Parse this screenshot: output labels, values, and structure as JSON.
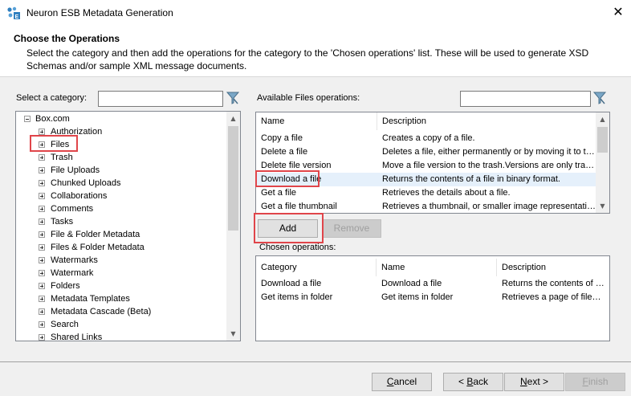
{
  "window": {
    "title": "Neuron ESB Metadata Generation",
    "close_glyph": "✕"
  },
  "header": {
    "title": "Choose the Operations",
    "description": "Select the category and then add the operations for the category to the 'Chosen operations' list. These will be used to generate XSD Schemas and/or sample XML message documents."
  },
  "category": {
    "label": "Select a category:",
    "search_value": "",
    "root": "Box.com",
    "items": [
      "Authorization",
      "Files",
      "Trash",
      "File Uploads",
      "Chunked Uploads",
      "Collaborations",
      "Comments",
      "Tasks",
      "File & Folder Metadata",
      "Files & Folder Metadata",
      "Watermarks",
      "Watermark",
      "Folders",
      "Metadata Templates",
      "Metadata Cascade (Beta)",
      "Search",
      "Shared Links"
    ],
    "selected": "Files"
  },
  "available": {
    "label": "Available Files operations:",
    "search_value": "",
    "columns": [
      "Name",
      "Description"
    ],
    "rows": [
      [
        "Copy a file",
        "Creates a copy of a file."
      ],
      [
        "Delete a file",
        "Deletes a file, either permanently or by moving it to the trash."
      ],
      [
        "Delete file version",
        "Move a file version to the trash.Versions are only tracked for premium accounts."
      ],
      [
        "Download a file",
        "Returns the contents of a file in binary format."
      ],
      [
        "Get a file",
        "Retrieves the details about a file."
      ],
      [
        "Get a file thumbnail",
        "Retrieves a thumbnail, or smaller image representation, of this file."
      ]
    ],
    "highlighted_row": "Download a file"
  },
  "actions": {
    "add": "Add",
    "remove": "Remove"
  },
  "chosen": {
    "label": "Chosen operations:",
    "columns": [
      "Category",
      "Name",
      "Description"
    ],
    "rows": [
      [
        "Download a file",
        "Download a file",
        "Returns the contents of a file in binary format."
      ],
      [
        "Get items in folder",
        "Get items in folder",
        "Retrieves a page of files and folders in a folder."
      ]
    ]
  },
  "footer": {
    "cancel": {
      "text": "Cancel",
      "accel": "C",
      "rest": "ancel"
    },
    "back": {
      "text": "< Back",
      "pre": "< ",
      "accel": "B",
      "rest": "ack"
    },
    "next": {
      "text": "Next >",
      "accel": "N",
      "rest": "ext >"
    },
    "finish": {
      "text": "Finish",
      "accel": "F",
      "rest": "inish"
    }
  },
  "colors": {
    "highlight_box": "#e0454a",
    "row_highlight": "#e5f0fb",
    "accent_icon": "#2f7fbf"
  }
}
